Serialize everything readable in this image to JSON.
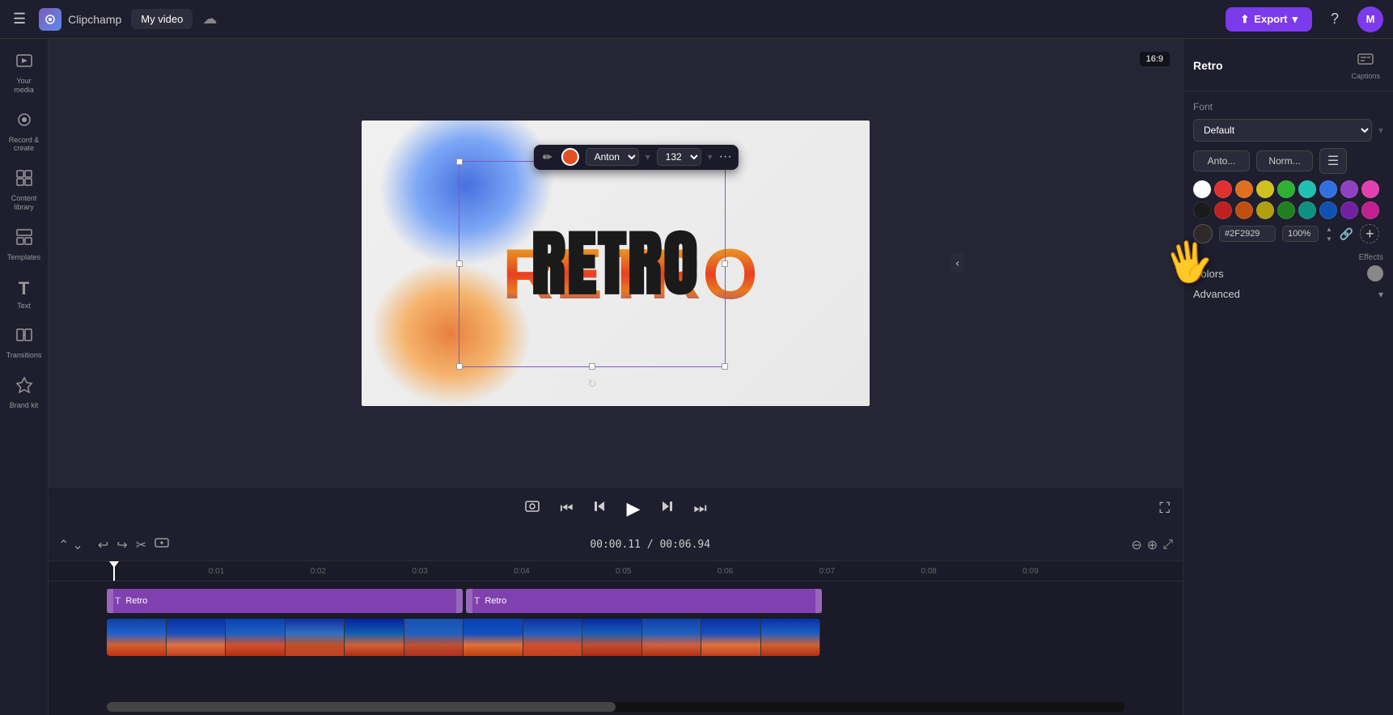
{
  "app": {
    "name": "Clipchamp",
    "title": "My video",
    "export_label": "Export",
    "help_label": "?",
    "avatar_label": "M"
  },
  "sidebar": {
    "items": [
      {
        "id": "your-media",
        "icon": "▤",
        "label": "Your media"
      },
      {
        "id": "record-create",
        "icon": "⬤",
        "label": "Record &\ncreate"
      },
      {
        "id": "content-library",
        "icon": "▦",
        "label": "Content\nlibrary"
      },
      {
        "id": "templates",
        "icon": "⊞",
        "label": "Templates"
      },
      {
        "id": "text",
        "icon": "T",
        "label": "Text"
      },
      {
        "id": "transitions",
        "icon": "⧩",
        "label": "Transitions"
      },
      {
        "id": "brand-kit",
        "icon": "🔷",
        "label": "Brand kit"
      }
    ]
  },
  "canvas": {
    "aspect_ratio": "16:9",
    "retro_text": "Retro"
  },
  "text_toolbar": {
    "edit_icon": "✏",
    "font_name": "Anton",
    "font_size": "132",
    "more_icon": "···"
  },
  "timeline": {
    "current_time": "00:00.11",
    "total_time": "00:06.94",
    "ruler_marks": [
      "0:01",
      "0:02",
      "0:03",
      "0:04",
      "0:05",
      "0:06",
      "0:07",
      "0:08",
      "0:09"
    ],
    "clips": [
      {
        "id": "clip1",
        "label": "Retro",
        "icon": "T"
      },
      {
        "id": "clip2",
        "label": "Retro",
        "icon": "T"
      }
    ]
  },
  "right_panel": {
    "title": "Retro",
    "captions_label": "Captions",
    "font_section_label": "Font",
    "font_dropdown_value": "Default",
    "font_name_value": "Anto...",
    "font_style_value": "Norm...",
    "font_align_icon": "☰",
    "swatches": [
      "white",
      "red1",
      "orange1",
      "yellow1",
      "green1",
      "teal1",
      "blue1",
      "purple1",
      "pink1",
      "black",
      "red2",
      "orange2",
      "yellow2",
      "green2",
      "teal2",
      "blue2",
      "purple2",
      "pink2"
    ],
    "hex_value": "#2F2929",
    "opacity_value": "100%",
    "effects_label": "Effects",
    "colors_section_label": "Colors",
    "advanced_label": "Advanced"
  }
}
